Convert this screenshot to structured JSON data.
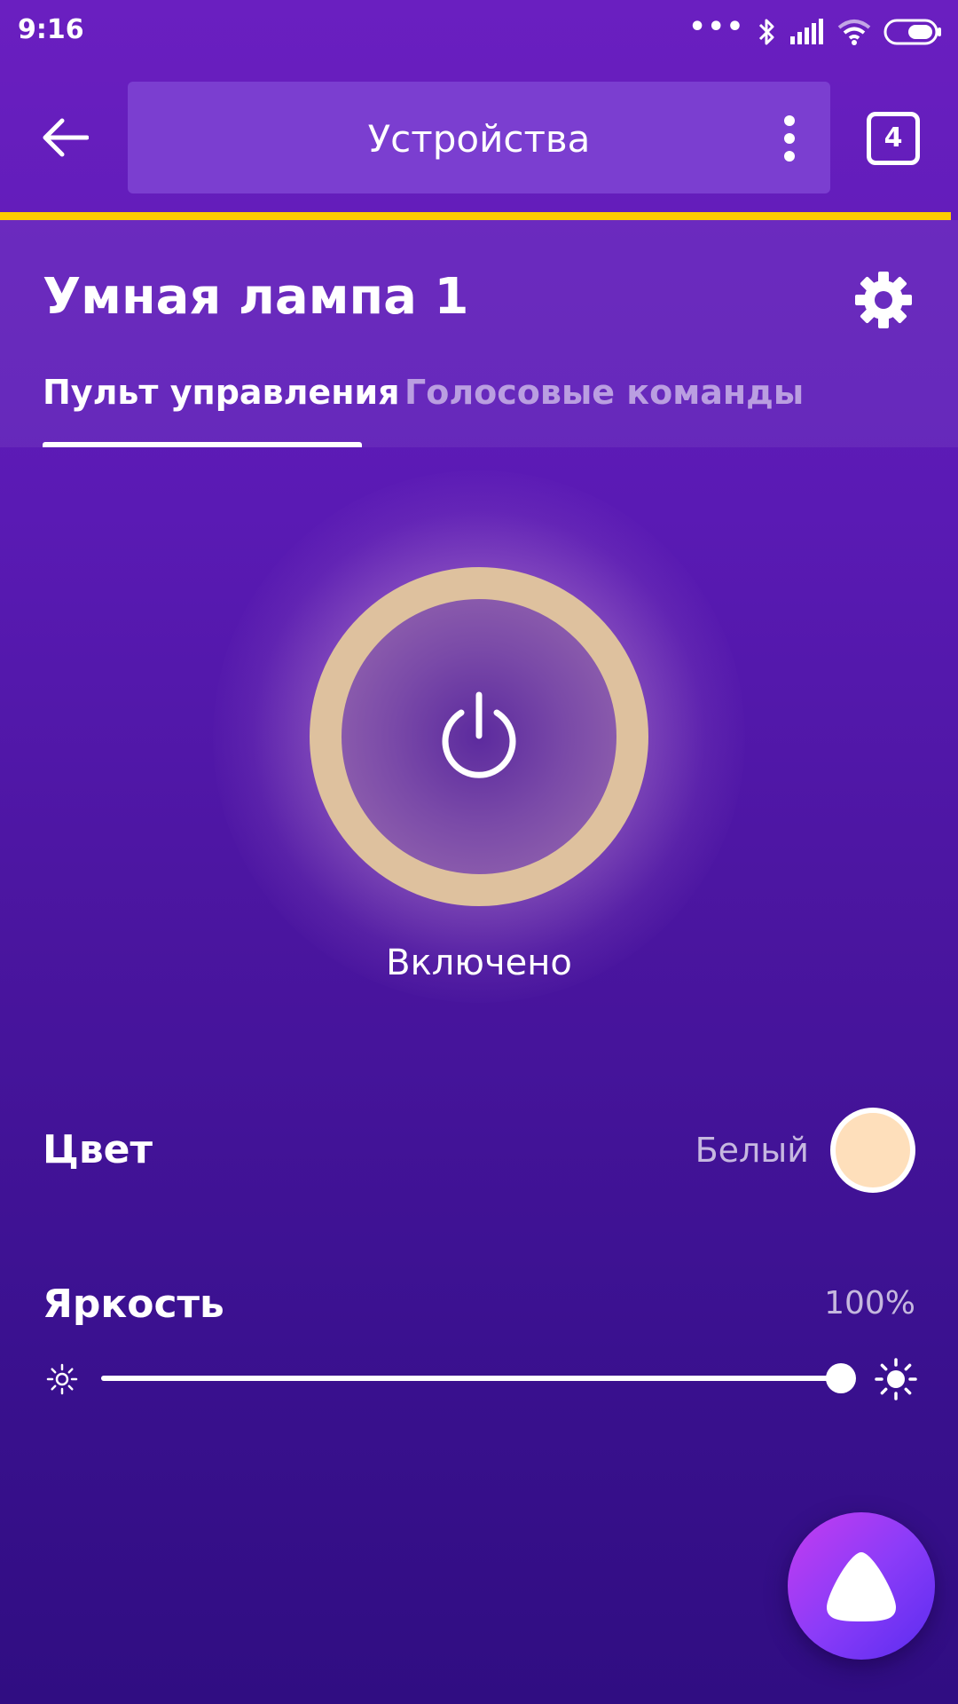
{
  "status_bar": {
    "time": "9:16",
    "icons": [
      "more-dots-icon",
      "bluetooth-icon",
      "signal-icon",
      "wifi-icon",
      "battery-icon"
    ]
  },
  "topbar": {
    "title": "Устройства",
    "tabs_count": "4"
  },
  "device": {
    "name": "Умная лампа 1",
    "tabs": [
      {
        "label": "Пульт управления",
        "active": true
      },
      {
        "label": "Голосовые команды",
        "active": false
      }
    ]
  },
  "power": {
    "status": "Включено",
    "on": true
  },
  "color": {
    "label": "Цвет",
    "value": "Белый",
    "swatch": "#fedfbb"
  },
  "brightness": {
    "label": "Яркость",
    "value_text": "100%",
    "level": 1.0
  },
  "theme": {
    "accent": "#ffcc00",
    "ring": "#dec19e"
  }
}
